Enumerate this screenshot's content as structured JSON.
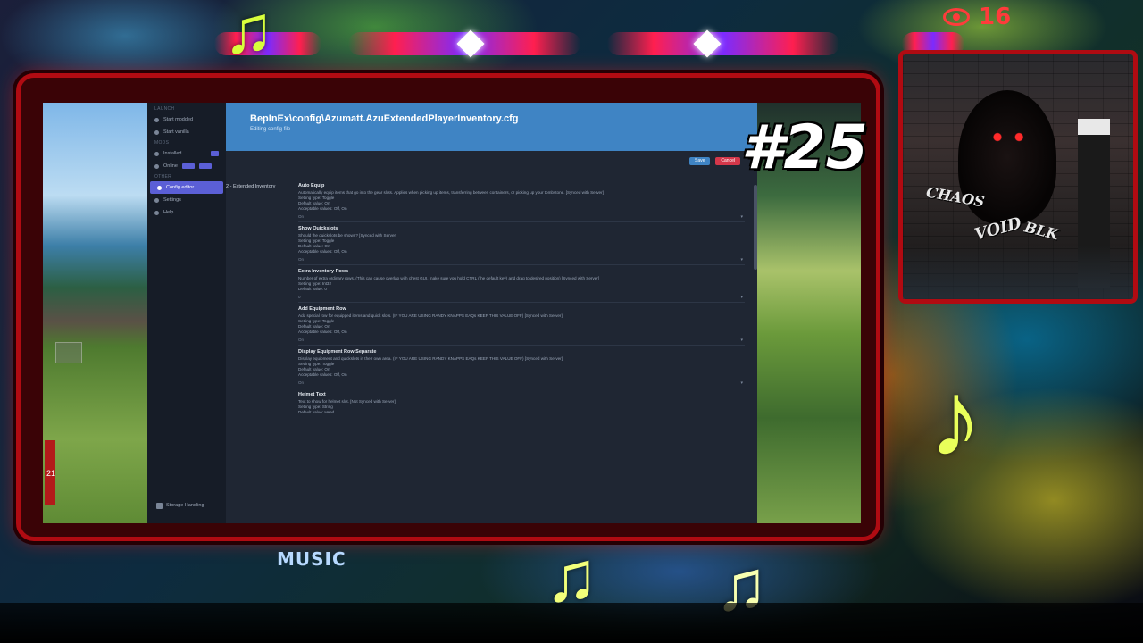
{
  "overlay": {
    "viewer_count": "16",
    "episode": "#25",
    "music_label": "MUSIC"
  },
  "webcam": {
    "graffiti_1": "CHAOS",
    "graffiti_2": "VOID",
    "graffiti_3": "BLK"
  },
  "app": {
    "sidebar": {
      "section_1": "Launch",
      "items_1": [
        {
          "label": "Start modded"
        },
        {
          "label": "Start vanilla"
        }
      ],
      "section_2": "Mods",
      "items_2": [
        {
          "label": "Installed"
        },
        {
          "label": "Online"
        }
      ],
      "section_3": "Other",
      "items_3": [
        {
          "label": "Config editor",
          "active": true
        },
        {
          "label": "Settings"
        },
        {
          "label": "Help"
        }
      ],
      "bottom_label": "Storage Handling"
    },
    "header": {
      "path": "BepInEx\\config\\Azumatt.AzuExtendedPlayerInventory.cfg",
      "subtitle": "Editing config file"
    },
    "buttons": {
      "save": "Save",
      "cancel": "Cancel"
    },
    "section": "2 - Extended Inventory",
    "entries": [
      {
        "title": "Auto Equip",
        "desc": [
          "Automatically equip items that go into the gear slots. Applies when picking up items, transferring between containers, or picking up your tombstone. [Synced with Server]",
          "Setting type: Toggle",
          "Default value: On",
          "Acceptable values: Off, On"
        ],
        "value": "On"
      },
      {
        "title": "Show Quickslots",
        "desc": [
          "Should the quickslots be shown? [Synced with Server]",
          "Setting type: Toggle",
          "Default value: On",
          "Acceptable values: Off, On"
        ],
        "value": "On"
      },
      {
        "title": "Extra Inventory Rows",
        "desc": [
          "Number of extra ordinary rows. (This can cause overlap with chest GUI, make sure you hold CTRL (the default key) and drag to desired position) [Synced with Server]",
          "Setting type: Int32",
          "Default value: 0"
        ],
        "value": "0"
      },
      {
        "title": "Add Equipment Row",
        "desc": [
          "Add special row for equipped items and quick slots. (IF YOU ARE USING RANDY KNAPPS EAQs KEEP THIS VALUE OFF) [Synced with Server]",
          "Setting type: Toggle",
          "Default value: On",
          "Acceptable values: Off, On"
        ],
        "value": "On"
      },
      {
        "title": "Display Equipment Row Separate",
        "desc": [
          "Display equipment and quickslots in their own area. (IF YOU ARE USING RANDY KNAPPS EAQs KEEP THIS VALUE OFF) [Synced with Server]",
          "Setting type: Toggle",
          "Default value: On",
          "Acceptable values: Off, On"
        ],
        "value": "On"
      },
      {
        "title": "Helmet Text",
        "desc": [
          "Text to show for helmet slot. [Not Synced with Server]",
          "Setting type: String",
          "Default value: Head"
        ],
        "value": ""
      }
    ]
  },
  "game_hud": {
    "health": "21"
  }
}
